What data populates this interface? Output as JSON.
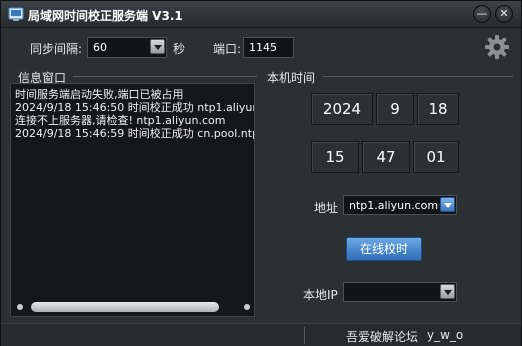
{
  "window": {
    "title": "局域网时间校正服务端 V3.1",
    "minimize_glyph": "—",
    "close_glyph": "✕"
  },
  "toolbar": {
    "sync_interval_label": "同步间隔:",
    "sync_interval_value": "60",
    "sync_interval_unit": "秒",
    "port_label": "端口:",
    "port_value": "1145",
    "settings_icon": "gear-icon"
  },
  "info_panel": {
    "title": "信息窗口",
    "lines": [
      "时间服务端启动失败,端口已被占用",
      "2024/9/18 15:46:50 时间校正成功 ntp1.aliyun.",
      "连接不上服务器,请检查! ntp1.aliyun.com",
      "2024/9/18 15:46:59 时间校正成功 cn.pool.ntp."
    ]
  },
  "local_time": {
    "title": "本机时间",
    "year": "2024",
    "month": "9",
    "day": "18",
    "hour": "15",
    "minute": "47",
    "second": "01"
  },
  "server": {
    "address_label": "地址",
    "address_value": "ntp1.aliyun.com",
    "sync_button": "在线校时",
    "local_ip_label": "本地IP",
    "local_ip_value": ""
  },
  "statusbar": {
    "forum": "吾爱破解论坛",
    "author": "y_w_o"
  },
  "colors": {
    "background": "#2b3034",
    "accent": "#3b78c0",
    "log_background": "#15181a"
  }
}
